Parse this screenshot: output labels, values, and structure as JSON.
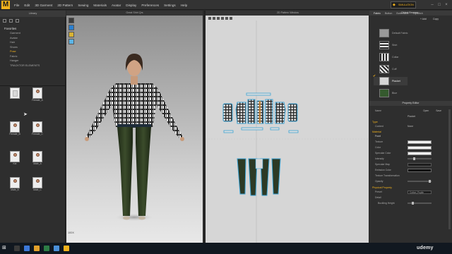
{
  "menu": {
    "logo": "M",
    "items": [
      "File",
      "Edit",
      "3D Garment",
      "2D Pattern",
      "Sewing",
      "Materials",
      "Avatar",
      "Display",
      "Preferences",
      "Settings",
      "Help"
    ],
    "simulation_label": "SIMULATION"
  },
  "library": {
    "header": "Library",
    "favorites_title": "Favorites",
    "favorites": [
      "Garment",
      "Avatar",
      "Hair",
      "Shoes",
      "Pose",
      "Fabric",
      "Hanger",
      "TRACKTOR ELEMENTS"
    ],
    "active_favorite": "Pose",
    "thumbnails": [
      {
        "label": "",
        "kind": "doc"
      },
      {
        "label": "Female_A",
        "kind": "avatar"
      },
      {
        "label": "Female_B",
        "kind": "avatar"
      },
      {
        "label": "Female_C",
        "kind": "avatar"
      },
      {
        "label": "Kid",
        "kind": "avatar"
      },
      {
        "label": "Male_A",
        "kind": "avatar"
      },
      {
        "label": "Male_B",
        "kind": "avatar"
      },
      {
        "label": "Male_C",
        "kind": "avatar"
      }
    ]
  },
  "viewport3d": {
    "title": "Great Shirt Qrs",
    "scale_label": "100X"
  },
  "viewport2d": {
    "title": "2D Pattern Window"
  },
  "object_browser": {
    "tabs": [
      "Fabric",
      "Button",
      "Buttonhole",
      "Topstitch"
    ],
    "header": "Object Browser",
    "add_label": "+ Add",
    "copy_label": "Copy",
    "fabrics": [
      {
        "name": "Default Fabric",
        "color": "#9a9a9a"
      },
      {
        "name": "Shirt",
        "color": "#7d7d7d"
      },
      {
        "name": "Collar",
        "color": "#a8a8a8"
      },
      {
        "name": "Cuff",
        "color": "#bdbdbd"
      },
      {
        "name": "Placket",
        "color": "#d0d0d0"
      },
      {
        "name": "Blue",
        "color": "#355a2e"
      }
    ],
    "selected_fabric": "Placket"
  },
  "property_editor": {
    "header": "Property Editor",
    "name_key": "Name",
    "name_value": "Placket",
    "open_label": "Open",
    "save_label": "Save",
    "type_section": "Type",
    "type_key": "Content",
    "type_value": "None",
    "material_section": "Material",
    "front_label": "Front",
    "rows": [
      {
        "k": "Texture",
        "kind": "white"
      },
      {
        "k": "Color",
        "kind": "white"
      },
      {
        "k": "Specular Color",
        "kind": "white"
      },
      {
        "k": "Intensity",
        "kind": "slider"
      },
      {
        "k": "Specular Map",
        "kind": "dark"
      },
      {
        "k": "Emission Color",
        "kind": "black"
      },
      {
        "k": "Texture Transformation",
        "kind": "none"
      },
      {
        "k": "Opacity",
        "kind": "slider"
      }
    ],
    "physical_section": "Physical Property",
    "preset_key": "Preset",
    "preset_value": "Cotton_Poplin",
    "detail_key": "Detail",
    "buckling_key": "Buckling Height"
  },
  "watermark": "udemy",
  "colors": {
    "accent": "#f2b21c",
    "panel_bg": "#2e2e2e",
    "outline": "#3ba3d4",
    "pattern_dark": "#2d3a25"
  }
}
